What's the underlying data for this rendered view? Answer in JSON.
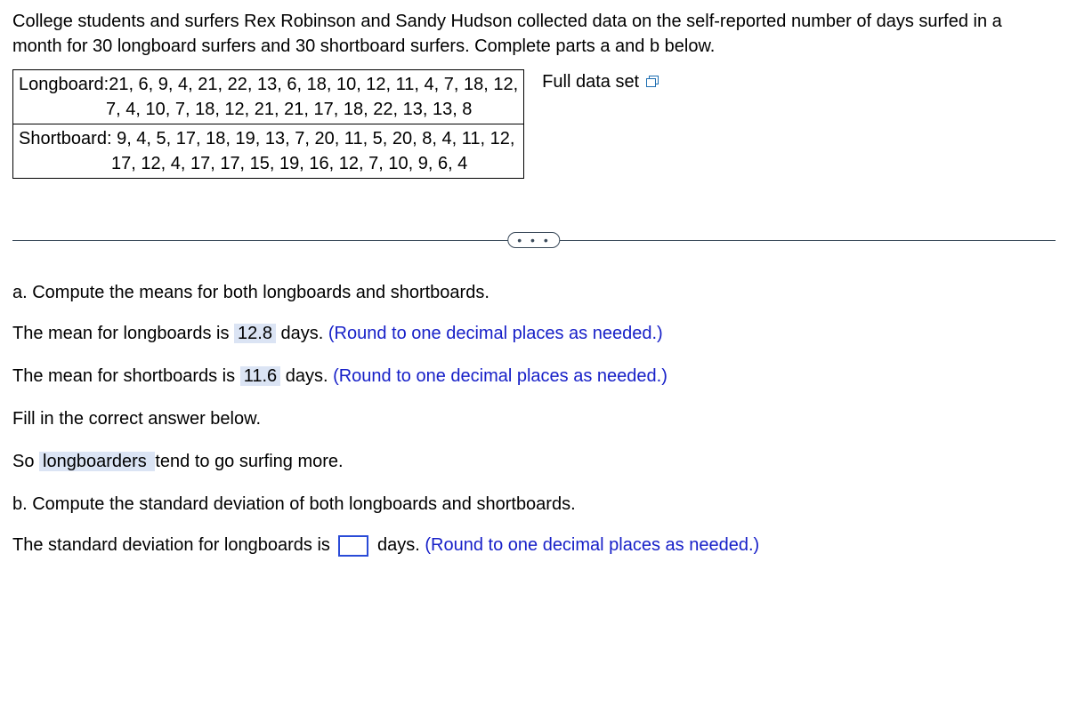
{
  "intro": "College students and surfers Rex Robinson and Sandy Hudson collected data on the self-reported number of days surfed in a month for 30 longboard surfers and 30 shortboard surfers. Complete parts a and b below.",
  "table": {
    "longboard_line1": "Longboard:21, 6, 9, 4, 21, 22, 13, 6, 18, 10, 12, 11, 4, 7, 18, 12,",
    "longboard_line2": "7, 4, 10, 7, 18, 12, 21, 21, 17, 18, 22, 13, 13, 8",
    "shortboard_line1": "Shortboard: 9, 4, 5, 17, 18, 19, 13, 7, 20, 11, 5, 20, 8, 4, 11, 12,",
    "shortboard_line2": "17, 12, 4, 17, 17, 15, 19, 16, 12, 7, 10, 9, 6, 4"
  },
  "full_data_label": "Full data set",
  "divider_dots": "• • •",
  "part_a": {
    "prompt": "a. Compute the means for both longboards and shortboards.",
    "long_prefix": "The mean for longboards is ",
    "long_value": "12.8",
    "long_suffix": " days. ",
    "round_note": "(Round to one decimal places as needed.)",
    "short_prefix": "The mean for shortboards is ",
    "short_value": "11.6",
    "short_suffix": " days. ",
    "fill_prompt": "Fill in the correct answer below.",
    "so_prefix": "So ",
    "so_value": " longboarders ",
    "so_suffix": " tend to go surfing more."
  },
  "part_b": {
    "prompt": "b. Compute the standard deviation of both longboards and shortboards.",
    "sd_prefix": "The standard deviation for longboards is ",
    "sd_suffix": " days. ",
    "round_note": "(Round to one decimal places as needed.)"
  }
}
